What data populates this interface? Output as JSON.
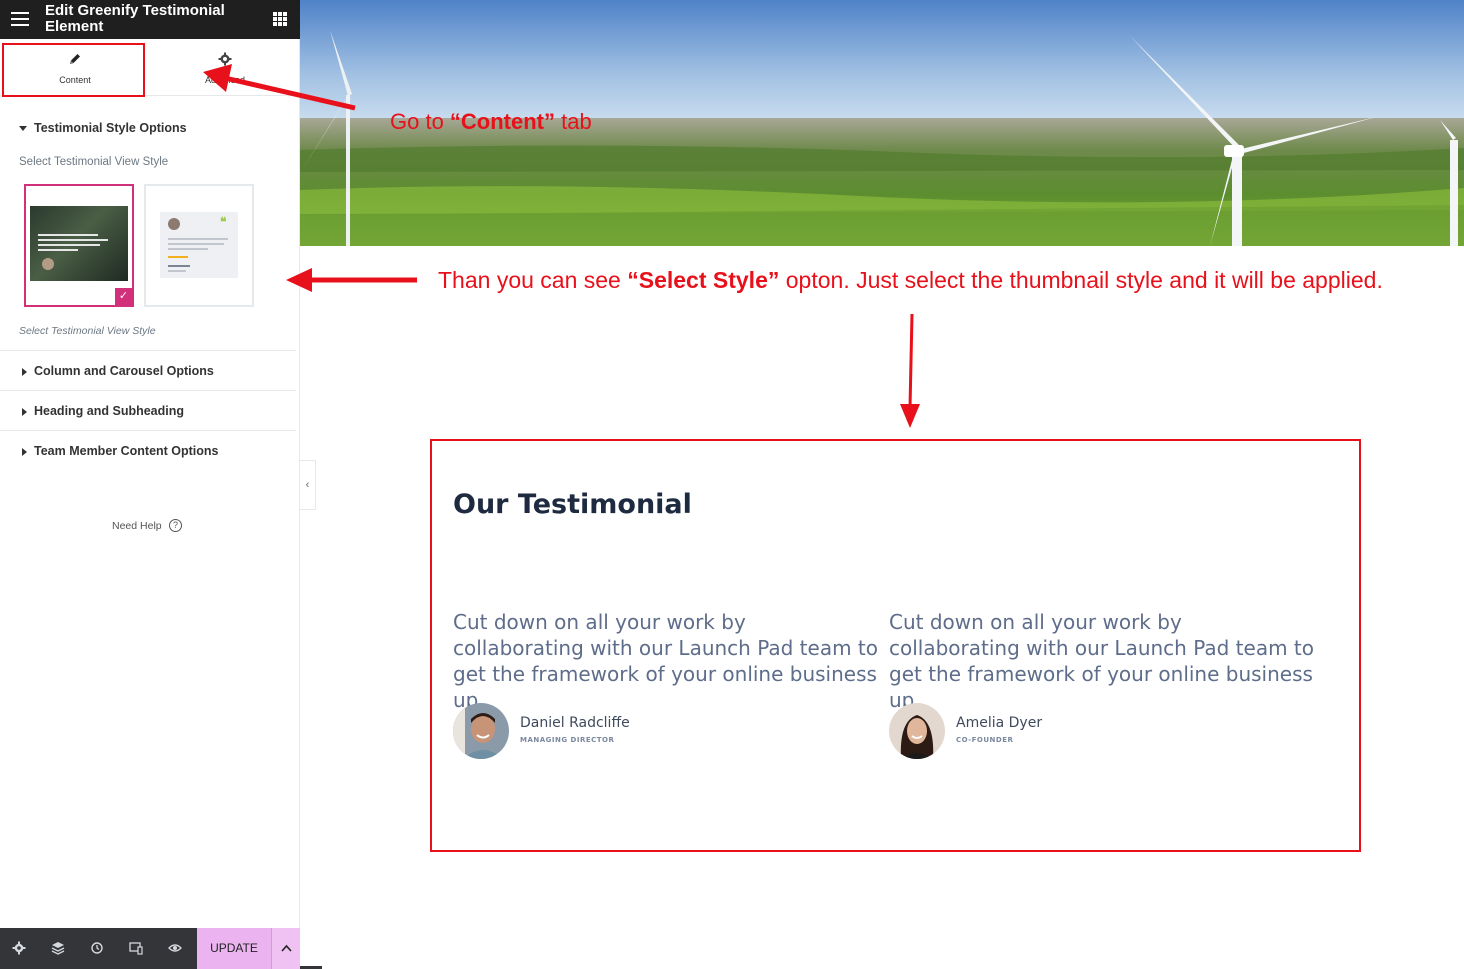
{
  "panel": {
    "title": "Edit Greenify Testimonial Element",
    "tabs": [
      {
        "label": "Content",
        "icon": "pencil-icon"
      },
      {
        "label": "Advanced",
        "icon": "gear-icon"
      }
    ],
    "sections": {
      "style_options": "Testimonial Style Options",
      "select_label": "Select Testimonial View Style",
      "select_hint": "Select Testimonial View Style",
      "column_carousel": "Column and Carousel Options",
      "heading_subheading": "Heading and Subheading",
      "team_member": "Team Member Content Options"
    },
    "need_help": "Need Help",
    "footer": {
      "update_label": "UPDATE",
      "icons": [
        "settings-icon",
        "layers-icon",
        "history-icon",
        "responsive-icon",
        "preview-eye-icon",
        "chevron-up-icon"
      ]
    },
    "selected_style": 1
  },
  "annotations": {
    "content_tab": {
      "pre": "Go  to ",
      "bold": "“Content”",
      "post": " tab"
    },
    "select_style": {
      "pre": "Than you  can see ",
      "bold": "“Select Style”",
      "post": " opton. Just select the thumbnail style and it will be applied."
    }
  },
  "preview": {
    "title": "Our Testimonial",
    "testimonials": [
      {
        "text": "Cut down on all your work by collaborating with our Launch Pad team to get the framework of your online business up.",
        "name": "Daniel Radcliffe",
        "role": "MANAGING DIRECTOR"
      },
      {
        "text": "Cut down on all your work by collaborating with our Launch Pad team to get the framework of your online business up.",
        "name": "Amelia Dyer",
        "role": "CO-FOUNDER"
      }
    ]
  },
  "colors": {
    "annotation_red": "#e8101a",
    "selected_border": "#d3307b",
    "update_button": "#ebb4f0",
    "heading": "#1e2a3f",
    "body_text": "#5e6d8a"
  }
}
